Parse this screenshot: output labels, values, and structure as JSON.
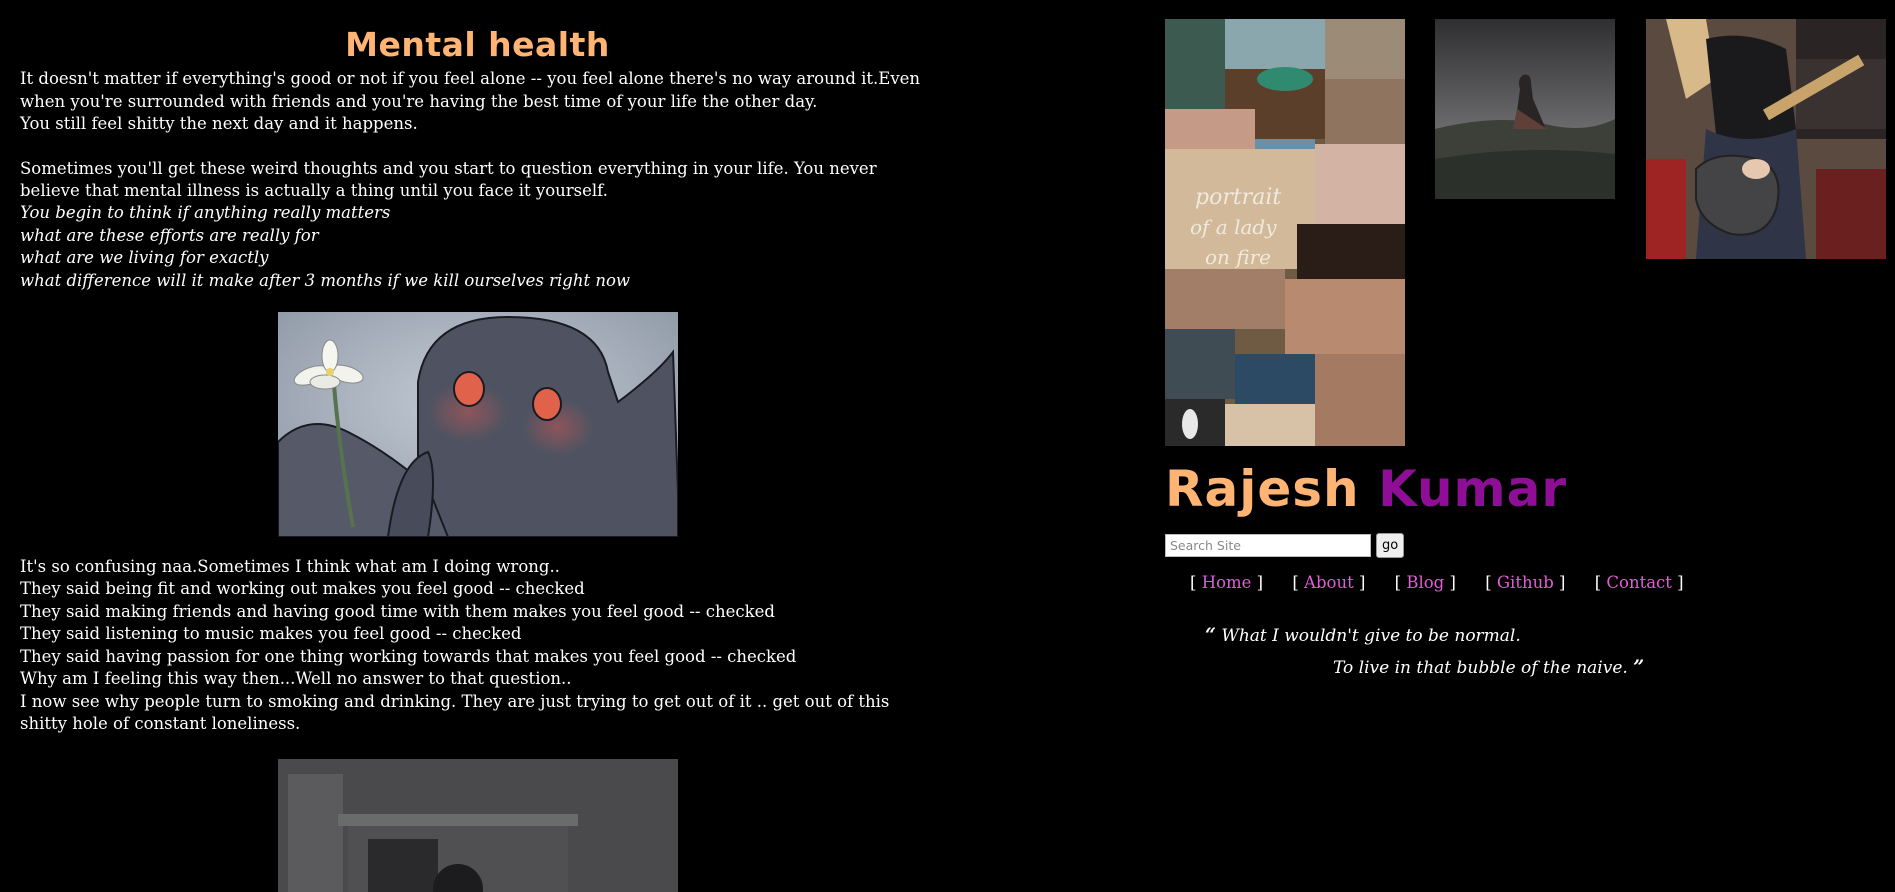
{
  "post": {
    "title": "Mental health",
    "para1": [
      "It doesn't matter if everything's good or not if you feel alone -- you feel alone there's no way around it.Even when you're surrounded with friends and you're having the best time of your life the other day.",
      "You still feel shitty the next day and it happens."
    ],
    "para2": "Sometimes you'll get these weird thoughts and you start to question everything in your life. You never believe that mental illness is actually a thing until you face it yourself.",
    "italic_lines": [
      "You begin to think if anything really matters",
      "what are these efforts are really for",
      "what are we living for exactly",
      "what difference will it make after 3 months if we kill ourselves right now"
    ],
    "para3": [
      "It's so confusing naa.Sometimes I think what am I doing wrong..",
      "They said being fit and working out makes you feel good -- checked",
      "They said making friends and having good time with them makes you feel good -- checked",
      "They said listening to music makes you feel good -- checked",
      "They said having passion for one thing working towards that makes you feel good -- checked",
      "Why am I feeling this way then...Well no answer to that question..",
      "I now see why people turn to smoking and drinking. They are just trying to get out of it .. get out of this shitty hole of constant loneliness."
    ]
  },
  "sidebar": {
    "name_first": "Rajesh",
    "name_last": "Kumar",
    "search_placeholder": "Search Site",
    "search_button": "go",
    "nav": [
      {
        "label": "Home"
      },
      {
        "label": "About"
      },
      {
        "label": "Blog"
      },
      {
        "label": "Github"
      },
      {
        "label": "Contact"
      }
    ],
    "quote_line1": "What I wouldn't give to be normal.",
    "quote_line2": "To live in that bubble of the naive.",
    "open_quote": "“",
    "close_quote": "”"
  },
  "colors": {
    "background": "#000000",
    "title_orange": "#ffb473",
    "name_purple": "#8e0f95",
    "link_pink": "#e35cd6"
  }
}
